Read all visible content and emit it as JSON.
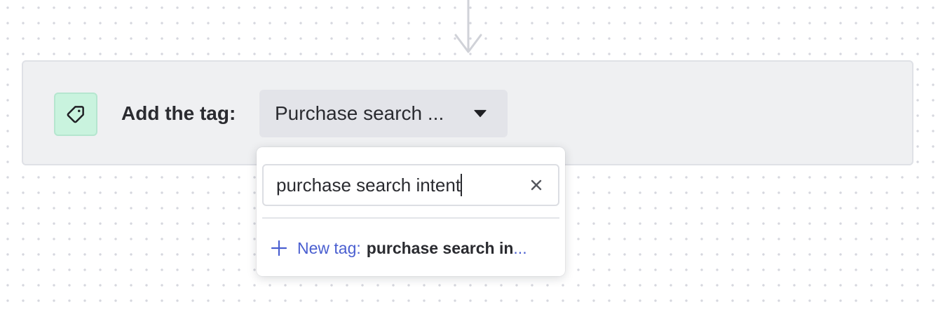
{
  "step": {
    "label": "Add the tag:",
    "icon": "tag-icon",
    "colors": {
      "card_bg": "#eff0f2",
      "icon_bg": "#c9f3de"
    }
  },
  "tag_select": {
    "value": "Purchase search ...",
    "icon": "caret-down-icon"
  },
  "dropdown": {
    "search": {
      "value": "purchase search intent",
      "clear_icon": "close-icon"
    },
    "new_tag": {
      "icon": "plus-icon",
      "prefix": "New tag:",
      "name": "purchase search in",
      "ellipsis": "...",
      "color": "#4a5fd0"
    }
  }
}
